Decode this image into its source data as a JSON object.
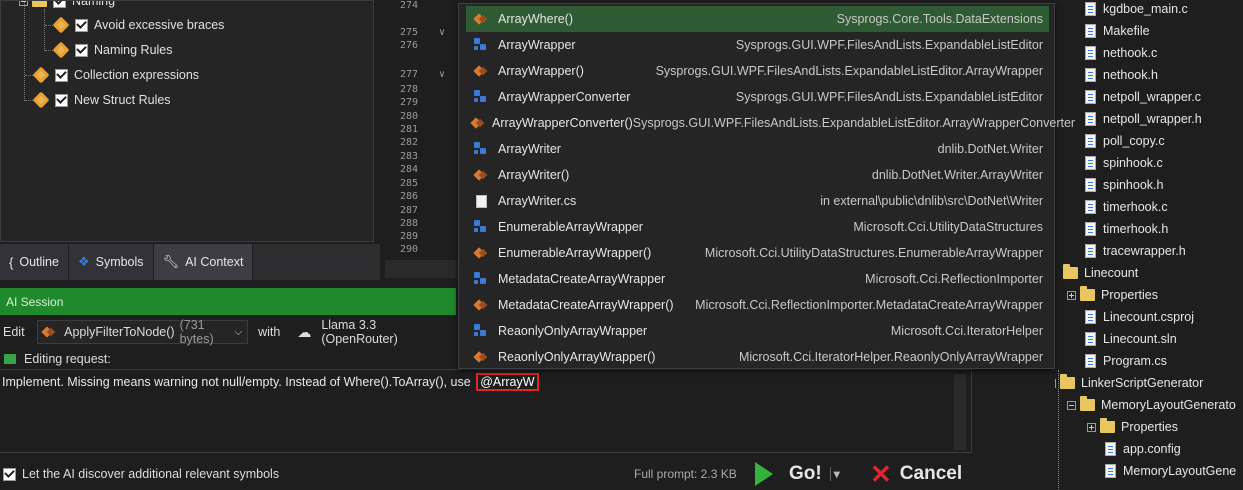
{
  "tree": {
    "items": [
      {
        "label": "Naming"
      },
      {
        "label": "Avoid excessive braces"
      },
      {
        "label": "Naming Rules"
      },
      {
        "label": "Collection expressions"
      },
      {
        "label": "New Struct Rules"
      }
    ]
  },
  "tabs": [
    {
      "label": "Outline",
      "icon": "braces-icon"
    },
    {
      "label": "Symbols",
      "icon": "symbols-icon"
    },
    {
      "label": "AI Context",
      "icon": "wrench-icon"
    }
  ],
  "gutter": {
    "lines": [
      "274",
      "275",
      "276",
      "277",
      "278",
      "279",
      "280",
      "281",
      "282",
      "283",
      "284",
      "285",
      "286",
      "287",
      "288",
      "289",
      "290"
    ]
  },
  "session": {
    "title": "AI Session"
  },
  "edit": {
    "label": "Edit",
    "target": "ApplyFilterToNode()",
    "target_size": "(731 bytes)",
    "with_label": "with",
    "model": "Llama 3.3 (OpenRouter)"
  },
  "editing": {
    "label": "Editing request:"
  },
  "request": {
    "text": "Implement. Missing means warning not null/empty. Instead of Where().ToArray(), use",
    "mention": "@ArrayW"
  },
  "bottom": {
    "discover_label": "Let the AI discover additional relevant symbols",
    "full_prompt": "Full prompt: 2.3 KB",
    "go_label": "Go!",
    "cancel_label": "Cancel"
  },
  "popup": {
    "items": [
      {
        "name": "ArrayWhere()",
        "ns": "Sysprogs.Core.Tools.DataExtensions",
        "kind": "method"
      },
      {
        "name": "ArrayWrapper",
        "ns": "Sysprogs.GUI.WPF.FilesAndLists.ExpandableListEditor",
        "kind": "class"
      },
      {
        "name": "ArrayWrapper()",
        "ns": "Sysprogs.GUI.WPF.FilesAndLists.ExpandableListEditor.ArrayWrapper",
        "kind": "method"
      },
      {
        "name": "ArrayWrapperConverter",
        "ns": "Sysprogs.GUI.WPF.FilesAndLists.ExpandableListEditor",
        "kind": "class"
      },
      {
        "name": "ArrayWrapperConverter()",
        "ns": "Sysprogs.GUI.WPF.FilesAndLists.ExpandableListEditor.ArrayWrapperConverter",
        "kind": "method"
      },
      {
        "name": "ArrayWriter",
        "ns": "dnlib.DotNet.Writer",
        "kind": "class"
      },
      {
        "name": "ArrayWriter()",
        "ns": "dnlib.DotNet.Writer.ArrayWriter",
        "kind": "method"
      },
      {
        "name": "ArrayWriter.cs",
        "ns": "in external\\public\\dnlib\\src\\DotNet\\Writer",
        "kind": "file"
      },
      {
        "name": "EnumerableArrayWrapper",
        "ns": "Microsoft.Cci.UtilityDataStructures",
        "kind": "class"
      },
      {
        "name": "EnumerableArrayWrapper()",
        "ns": "Microsoft.Cci.UtilityDataStructures.EnumerableArrayWrapper",
        "kind": "method"
      },
      {
        "name": "MetadataCreateArrayWrapper",
        "ns": "Microsoft.Cci.ReflectionImporter",
        "kind": "class"
      },
      {
        "name": "MetadataCreateArrayWrapper()",
        "ns": "Microsoft.Cci.ReflectionImporter.MetadataCreateArrayWrapper",
        "kind": "method"
      },
      {
        "name": "ReaonlyOnlyArrayWrapper",
        "ns": "Microsoft.Cci.IteratorHelper",
        "kind": "class"
      },
      {
        "name": "ReaonlyOnlyArrayWrapper()",
        "ns": "Microsoft.Cci.IteratorHelper.ReaonlyOnlyArrayWrapper",
        "kind": "method"
      }
    ]
  },
  "solution": {
    "items": [
      {
        "label": "kgdboe_main.c",
        "type": "file"
      },
      {
        "label": "Makefile",
        "type": "file"
      },
      {
        "label": "nethook.c",
        "type": "file"
      },
      {
        "label": "nethook.h",
        "type": "file"
      },
      {
        "label": "netpoll_wrapper.c",
        "type": "file"
      },
      {
        "label": "netpoll_wrapper.h",
        "type": "file"
      },
      {
        "label": "poll_copy.c",
        "type": "file"
      },
      {
        "label": "spinhook.c",
        "type": "file"
      },
      {
        "label": "spinhook.h",
        "type": "file"
      },
      {
        "label": "timerhook.c",
        "type": "file"
      },
      {
        "label": "timerhook.h",
        "type": "file"
      },
      {
        "label": "tracewrapper.h",
        "type": "file"
      },
      {
        "label": "Linecount",
        "type": "folder"
      },
      {
        "label": "Properties",
        "type": "folder"
      },
      {
        "label": "Linecount.csproj",
        "type": "file"
      },
      {
        "label": "Linecount.sln",
        "type": "file"
      },
      {
        "label": "Program.cs",
        "type": "file"
      },
      {
        "label": "LinkerScriptGenerator",
        "type": "folder"
      },
      {
        "label": "MemoryLayoutGenerato",
        "type": "folder"
      },
      {
        "label": "Properties",
        "type": "folder"
      },
      {
        "label": "app.config",
        "type": "file"
      },
      {
        "label": "MemoryLayoutGene",
        "type": "file"
      }
    ]
  }
}
